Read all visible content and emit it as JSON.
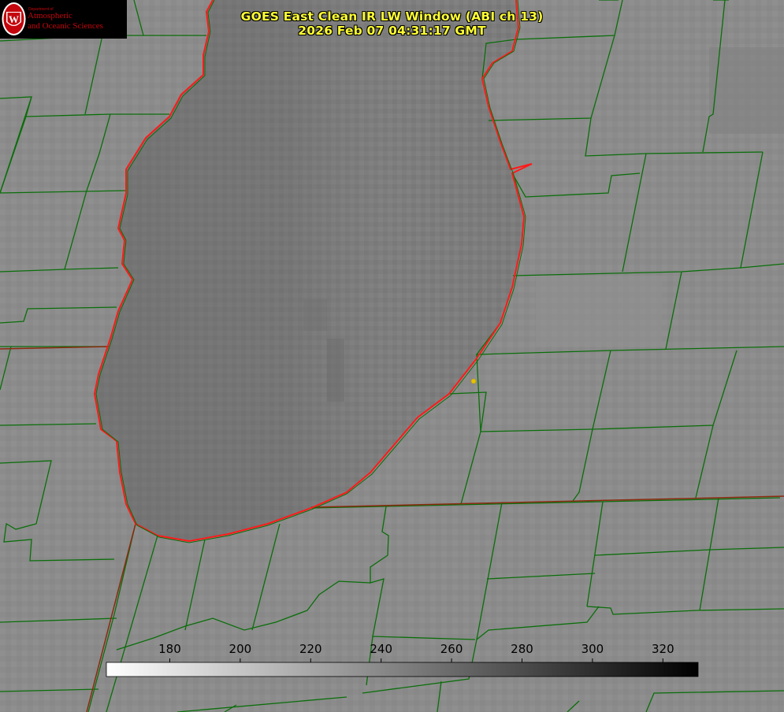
{
  "title": {
    "line1": "GOES East Clean IR LW Window (ABI ch 13)",
    "line2": "2026 Feb 07 04:31:17 GMT"
  },
  "logo": {
    "department": "Department of",
    "line1": "Atmospheric",
    "line2": "and Oceanic Sciences"
  },
  "colorbar": {
    "ticks": [
      "180",
      "200",
      "220",
      "240",
      "260",
      "280",
      "300",
      "320"
    ],
    "tick_values": [
      180,
      200,
      220,
      240,
      260,
      280,
      300,
      320
    ],
    "min": 162,
    "max": 330,
    "gradient_start": "#ffffff",
    "gradient_end": "#000000"
  },
  "colors": {
    "county_lines": "#0a6e0a",
    "coastline": "#ff1a1a",
    "title": "#ffff33",
    "marker": "#e6c200"
  }
}
